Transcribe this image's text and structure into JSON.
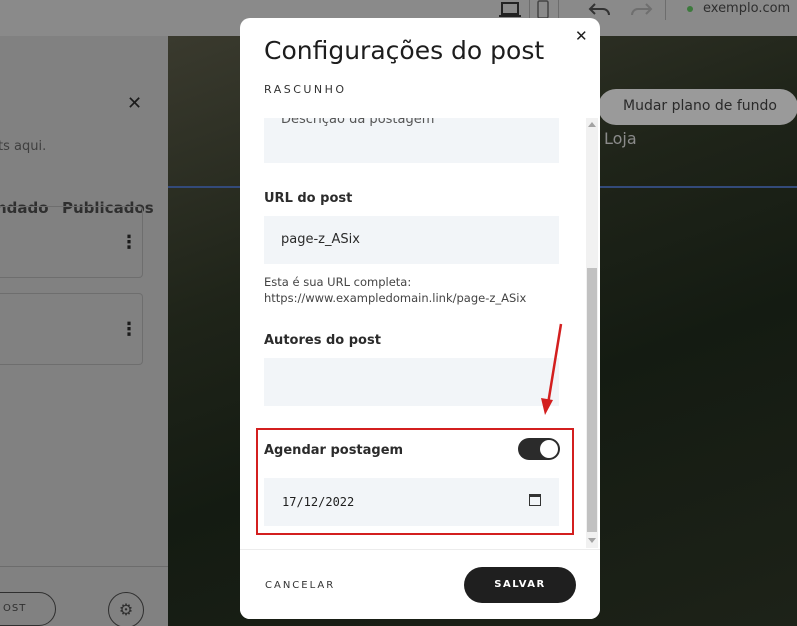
{
  "topbar": {
    "domain": "exemplo.com",
    "icons": [
      "desktop-icon",
      "mobile-icon",
      "undo-icon",
      "redo-icon"
    ]
  },
  "left_panel": {
    "hint": "ts aqui.",
    "tabs": [
      "ndado",
      "Publicados"
    ],
    "new_post_button": "OST"
  },
  "canvas": {
    "change_background_button": "Mudar plano de fundo",
    "shop_label": "Loja"
  },
  "modal": {
    "title": "Configurações do post",
    "status": "RASCUNHO",
    "description_placeholder": "Descrição da postagem",
    "url_label": "URL do post",
    "url_value": "page-z_ASix",
    "url_helper_line1": "Esta é sua URL completa:",
    "url_helper_line2": "https://www.exampledomain.link/page-z_ASix",
    "authors_label": "Autores do post",
    "authors_value": "",
    "schedule_label": "Agendar postagem",
    "schedule_enabled": true,
    "schedule_date": "17/12/2022",
    "cancel_label": "CANCELAR",
    "save_label": "SALVAR"
  },
  "colors": {
    "highlight": "#d31f1f",
    "primary_button": "#1f1f1f",
    "input_background": "#f2f5f8"
  }
}
